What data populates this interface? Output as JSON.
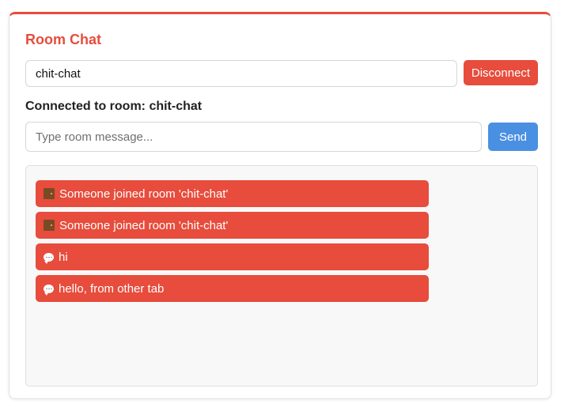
{
  "header": {
    "title": "Room Chat"
  },
  "room": {
    "value": "chit-chat",
    "disconnect_label": "Disconnect"
  },
  "status": {
    "text": "Connected to room: chit-chat"
  },
  "composer": {
    "placeholder": "Type room message...",
    "value": "",
    "send_label": "Send"
  },
  "colors": {
    "accent": "#e74c3c",
    "send": "#4a90e2"
  },
  "messages": [
    {
      "icon": "door-icon",
      "text": "Someone joined room 'chit-chat'"
    },
    {
      "icon": "door-icon",
      "text": "Someone joined room 'chit-chat'"
    },
    {
      "icon": "speech-bubble-icon",
      "text": "hi"
    },
    {
      "icon": "speech-bubble-icon",
      "text": "hello, from other tab"
    }
  ]
}
